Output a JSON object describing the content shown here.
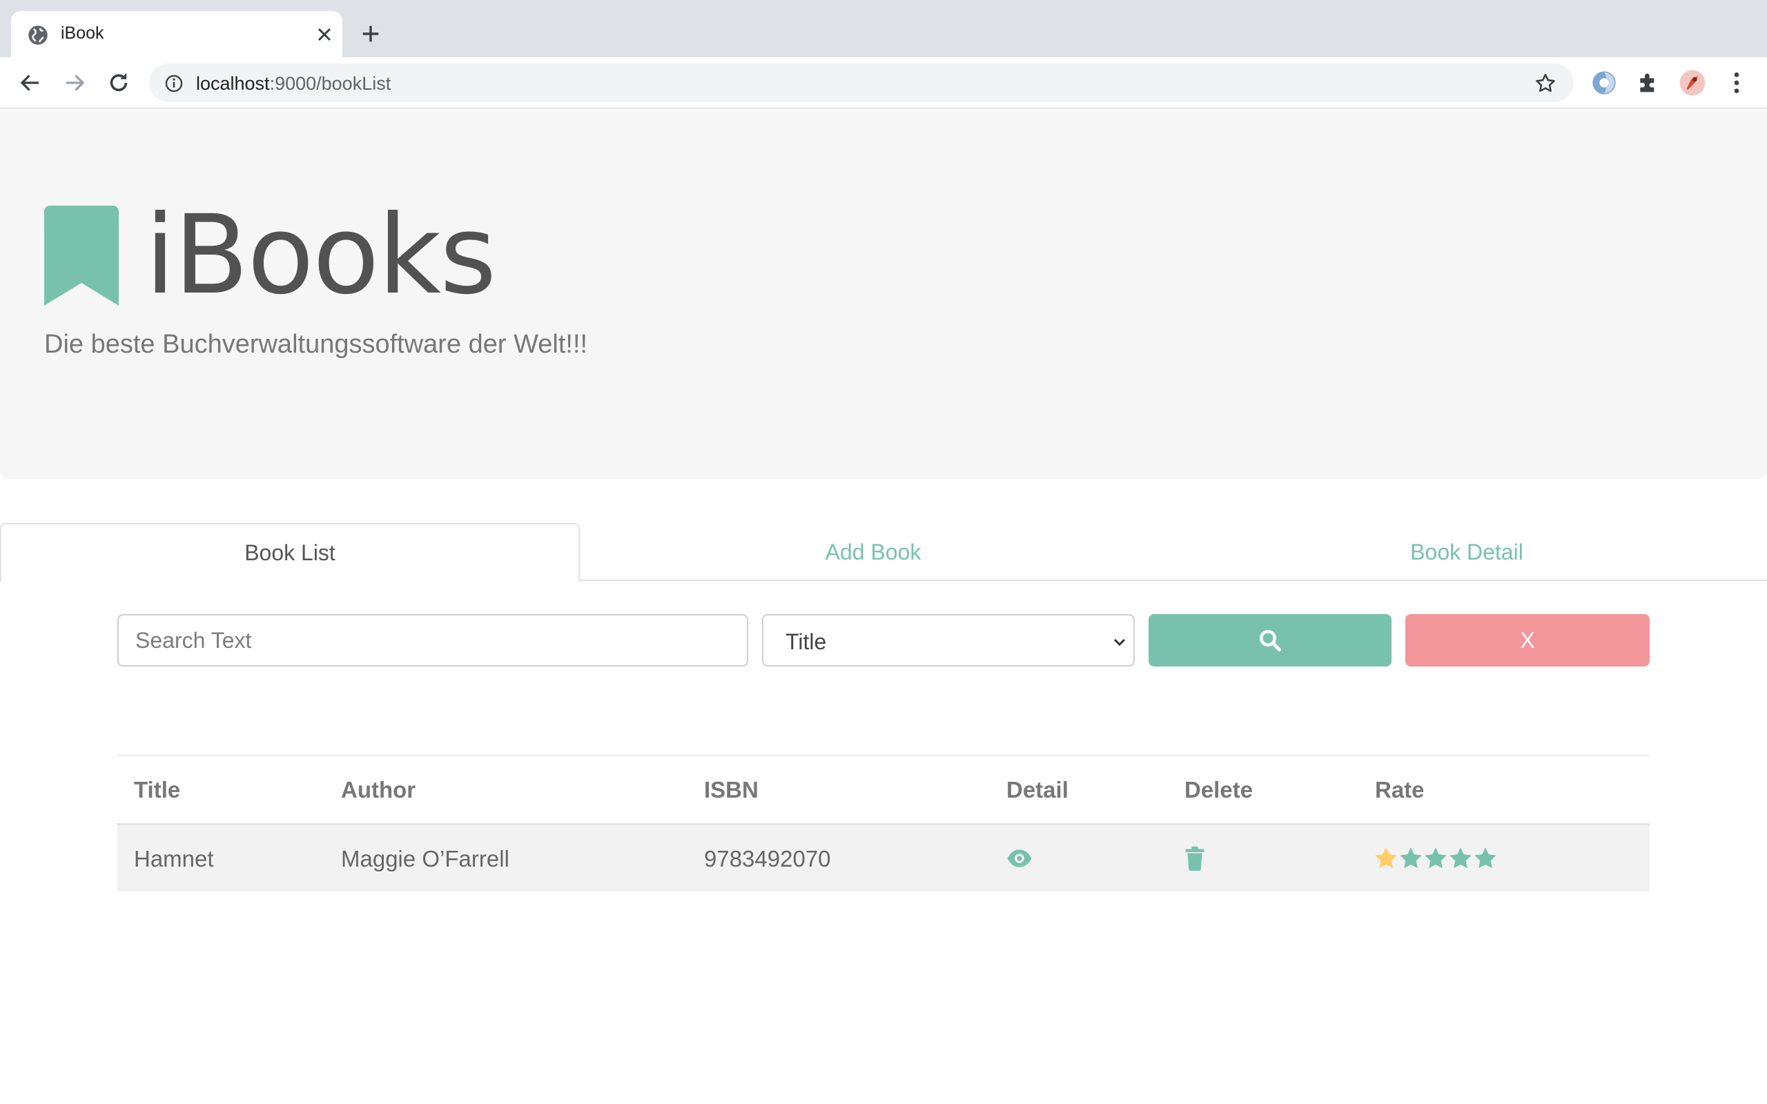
{
  "browser": {
    "tab_title": "iBook",
    "url_host": "localhost",
    "url_path": ":9000/bookList"
  },
  "header": {
    "brand": "iBooks",
    "tagline": "Die beste Buchverwaltungssoftware der Welt!!!"
  },
  "tabs": [
    {
      "label": "Book List",
      "active": true
    },
    {
      "label": "Add Book",
      "active": false
    },
    {
      "label": "Book Detail",
      "active": false
    }
  ],
  "search": {
    "placeholder": "Search Text",
    "value": "",
    "field_selected": "Title",
    "clear_label": "X"
  },
  "table": {
    "columns": [
      "Title",
      "Author",
      "ISBN",
      "Detail",
      "Delete",
      "Rate"
    ],
    "rows": [
      {
        "title": "Hamnet",
        "author": "Maggie O’Farrell",
        "isbn": "9783492070",
        "rating": 1,
        "max_rating": 5
      }
    ]
  },
  "colors": {
    "primary": "#78c2ad",
    "danger": "#f3969a",
    "star_filled": "#ffce67",
    "star_empty": "#78c2ad"
  },
  "icons": {
    "logo": "bookmark-icon",
    "search_button": "search-icon",
    "detail": "eye-icon",
    "delete": "trash-icon",
    "rate": "star-icon"
  }
}
